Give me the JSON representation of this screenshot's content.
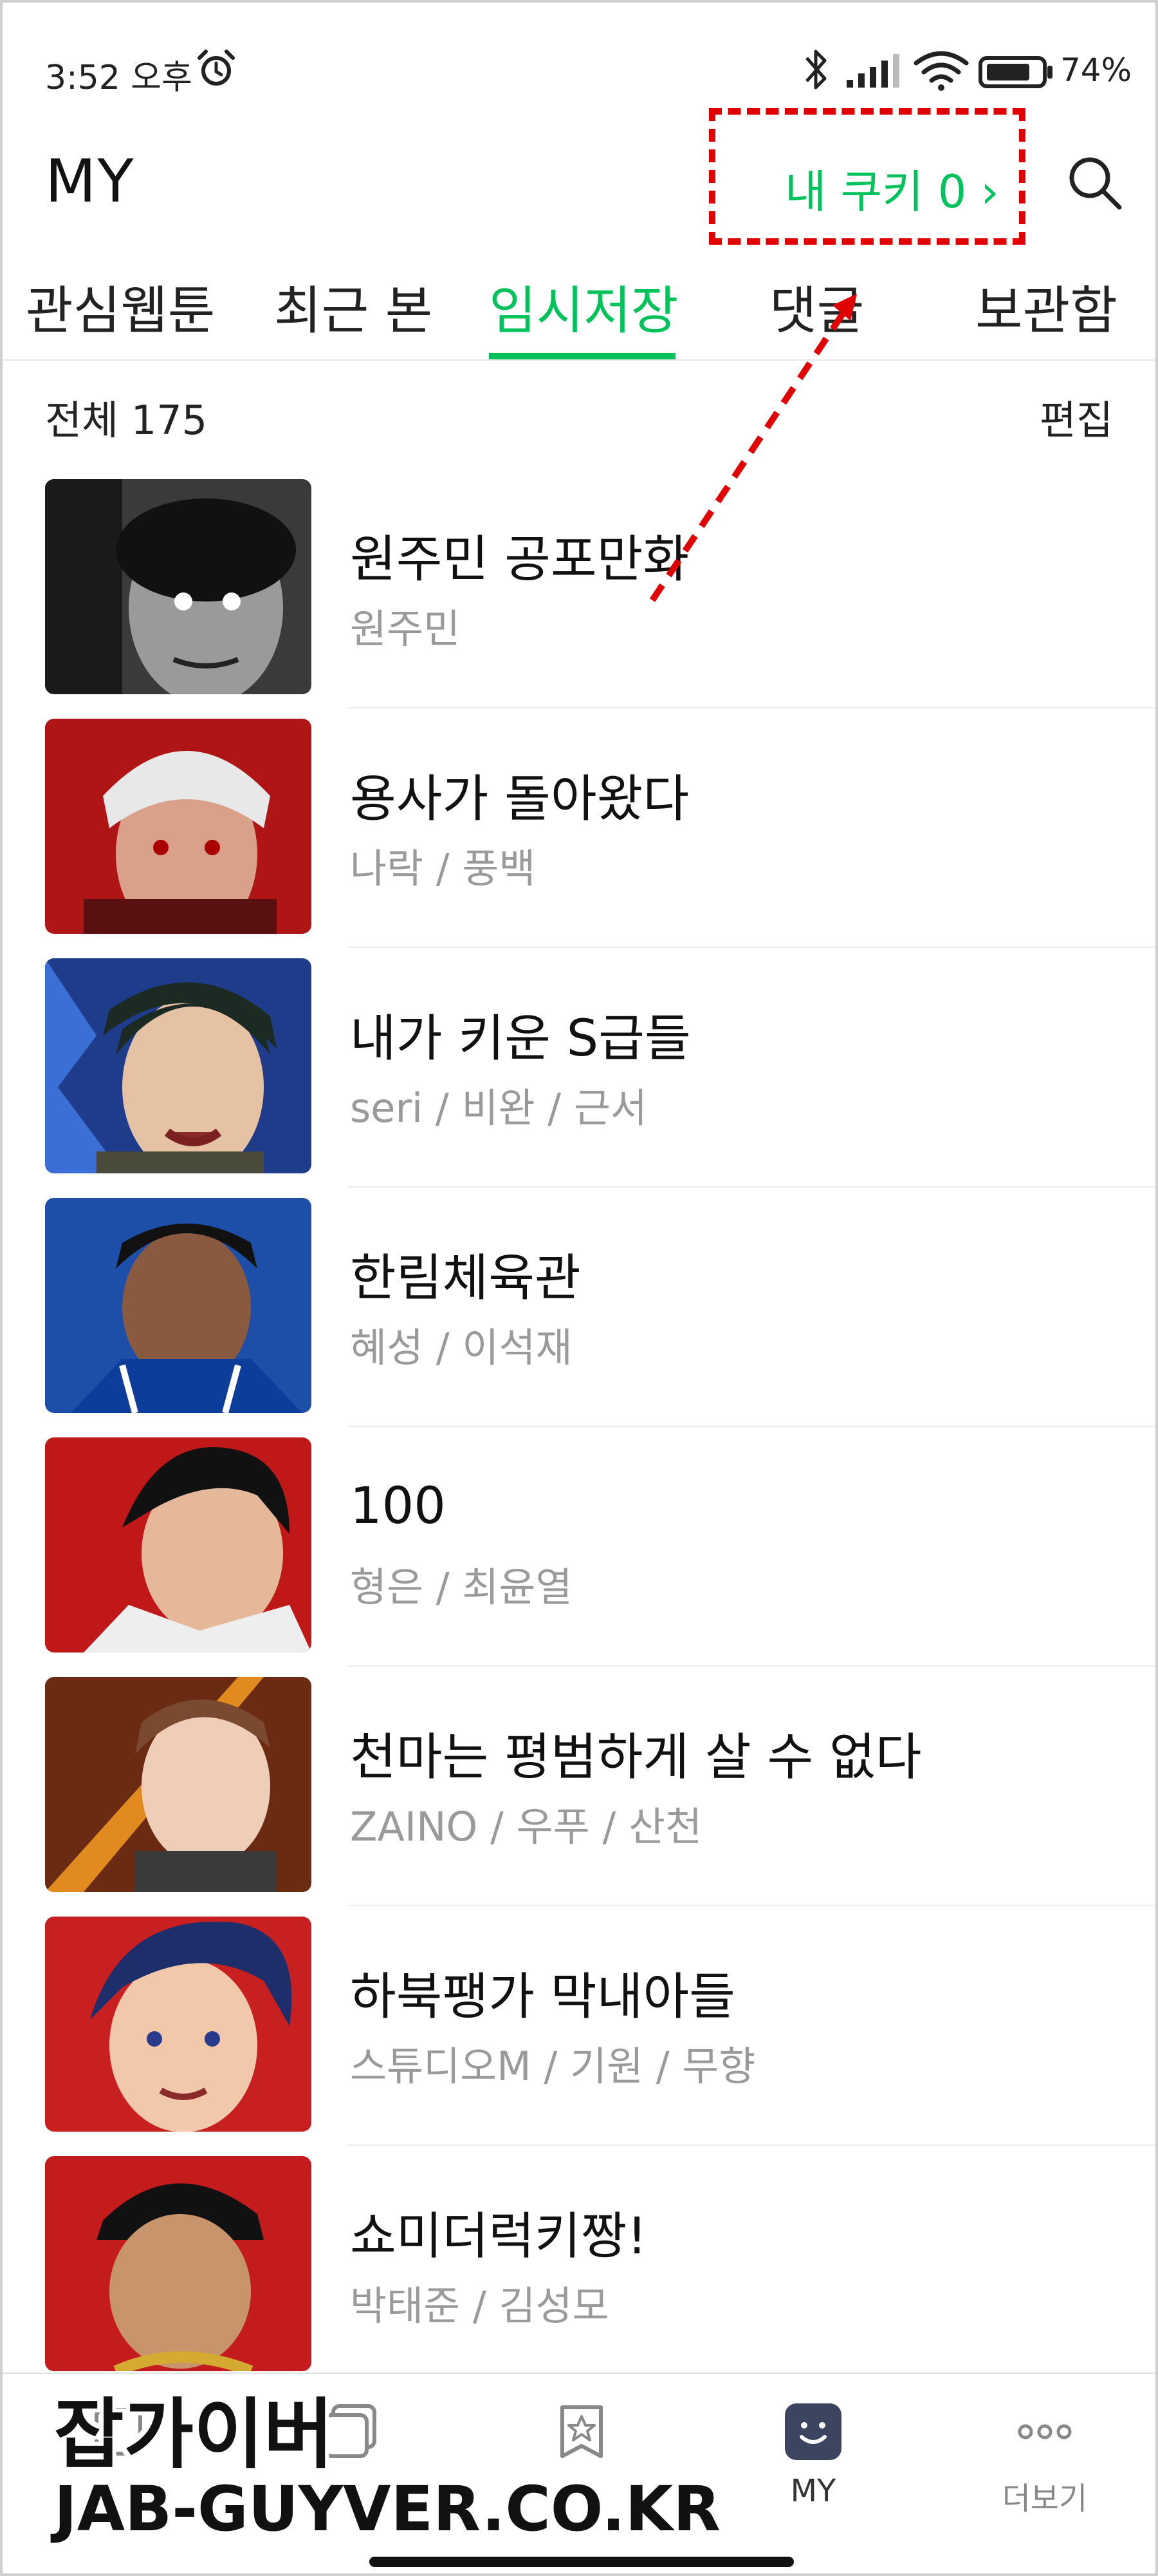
{
  "status_bar": {
    "time": "3:52 오후",
    "battery_percent": "74%",
    "icons": [
      "alarm-icon",
      "bluetooth-icon",
      "signal-icon",
      "wifi-icon",
      "battery-icon"
    ]
  },
  "header": {
    "title": "MY",
    "cookie_label": "내 쿠키 0 ›",
    "search_icon": "search-icon"
  },
  "tabs": [
    {
      "label": "관심웹툰",
      "active": false
    },
    {
      "label": "최근 본",
      "active": false
    },
    {
      "label": "임시저장",
      "active": true
    },
    {
      "label": "댓글",
      "active": false
    },
    {
      "label": "보관함",
      "active": false
    }
  ],
  "list": {
    "total_label": "전체 175",
    "edit_label": "편집",
    "items": [
      {
        "title": "원주민 공포만화",
        "authors": "원주민"
      },
      {
        "title": "용사가 돌아왔다",
        "authors": "나락 / 풍백"
      },
      {
        "title": "내가 키운 S급들",
        "authors": "seri / 비완 / 근서"
      },
      {
        "title": "한림체육관",
        "authors": "혜성 / 이석재"
      },
      {
        "title": "100",
        "authors": "형은 / 최윤열"
      },
      {
        "title": "천마는 평범하게 살 수 없다",
        "authors": "ZAINO / 우푸 / 산천"
      },
      {
        "title": "하북팽가 막내아들",
        "authors": "스튜디오M / 기원 / 무향"
      },
      {
        "title": "쇼미더럭키짱!",
        "authors": "박태준 / 김성모"
      }
    ]
  },
  "bottom_nav": [
    {
      "label": "",
      "icon": "webtoon-icon",
      "active": false
    },
    {
      "label": "",
      "icon": "completed-icon",
      "active": false
    },
    {
      "label": "",
      "icon": "best-challenge-icon",
      "active": false
    },
    {
      "label": "MY",
      "icon": "my-face-icon",
      "active": true
    },
    {
      "label": "더보기",
      "icon": "more-dots-icon",
      "active": false
    }
  ],
  "watermark": {
    "line1": "잡가이버",
    "line2": "JAB-GUYVER.CO.KR"
  },
  "colors": {
    "accent_green": "#00c25a",
    "annotation_red": "#e00000",
    "author_gray": "#9a9a9a"
  }
}
